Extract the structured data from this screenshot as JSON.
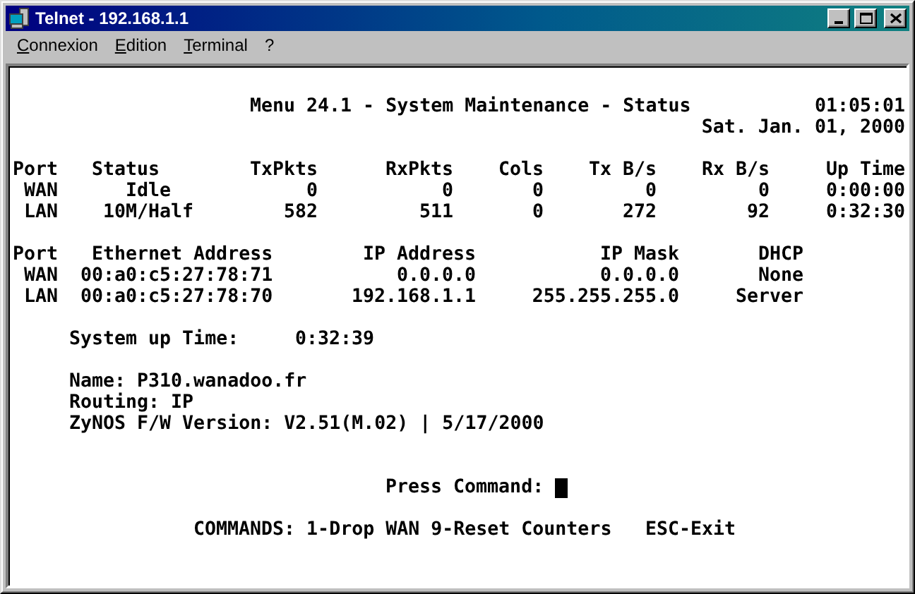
{
  "window": {
    "title": "Telnet - 192.168.1.1"
  },
  "menu_bar": [
    "Connexion",
    "Edition",
    "Terminal",
    "?"
  ],
  "terminal": {
    "heading": "Menu 24.1 - System Maintenance - Status",
    "time": "01:05:01",
    "date": "Sat. Jan. 01, 2000",
    "port_status": {
      "columns": [
        "Port",
        "Status",
        "TxPkts",
        "RxPkts",
        "Cols",
        "Tx B/s",
        "Rx B/s",
        "Up Time"
      ],
      "rows": [
        [
          "WAN",
          "Idle",
          "0",
          "0",
          "0",
          "0",
          "0",
          "0:00:00"
        ],
        [
          "LAN",
          "10M/Half",
          "582",
          "511",
          "0",
          "272",
          "92",
          "0:32:30"
        ]
      ]
    },
    "port_addresses": {
      "columns": [
        "Port",
        "Ethernet Address",
        "IP Address",
        "IP Mask",
        "DHCP"
      ],
      "rows": [
        [
          "WAN",
          "00:a0:c5:27:78:71",
          "0.0.0.0",
          "0.0.0.0",
          "None"
        ],
        [
          "LAN",
          "00:a0:c5:27:78:70",
          "192.168.1.1",
          "255.255.255.0",
          "Server"
        ]
      ]
    },
    "uptime": {
      "label": "System up Time:",
      "value": "0:32:39"
    },
    "info_lines": [
      "Name: P310.wanadoo.fr",
      "Routing: IP",
      "ZyNOS F/W Version: V2.51(M.02) | 5/17/2000"
    ],
    "prompt": "Press Command:",
    "commands": [
      "COMMANDS: 1-Drop WAN 9-Reset Counters",
      "ESC-Exit"
    ]
  }
}
